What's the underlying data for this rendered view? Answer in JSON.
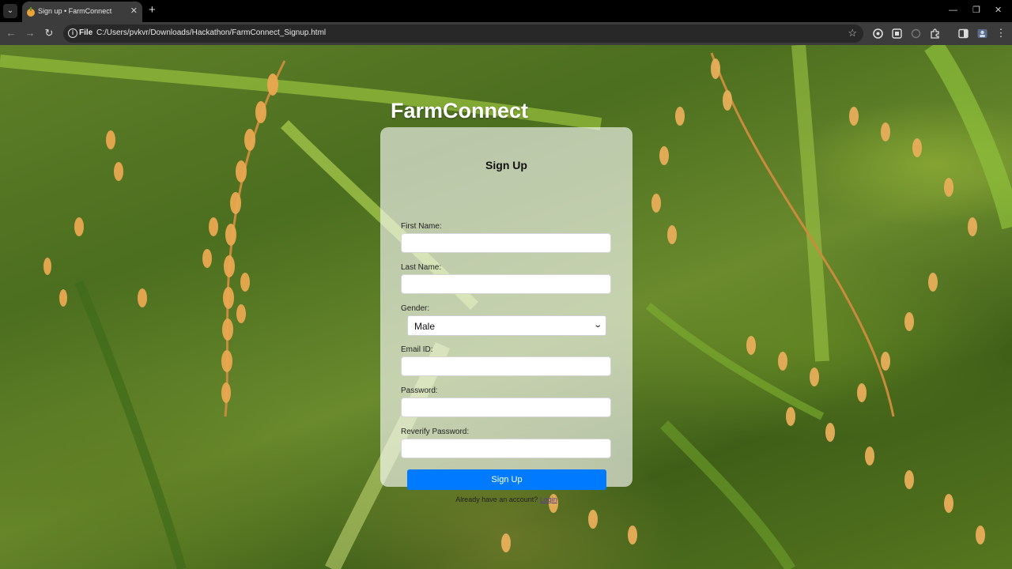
{
  "browser": {
    "tab_title": "Sign up • FarmConnect",
    "file_chip": "File",
    "url": "C:/Users/pvkvr/Downloads/Hackathon/FarmConnect_Signup.html"
  },
  "page": {
    "brand": "FarmConnect",
    "form": {
      "title": "Sign Up",
      "first_name_label": "First Name:",
      "last_name_label": "Last Name:",
      "gender_label": "Gender:",
      "gender_value": "Male",
      "email_label": "Email ID:",
      "password_label": "Password:",
      "reverify_label": "Reverify Password:",
      "first_name_value": "",
      "last_name_value": "",
      "email_value": "",
      "password_value": "",
      "reverify_value": "",
      "submit_label": "Sign Up",
      "login_prompt": "Already have an account?",
      "login_link": "Login"
    }
  },
  "colors": {
    "accent": "#007bff",
    "link": "#5a3d8a",
    "chrome_bg": "#3c3c3c"
  }
}
